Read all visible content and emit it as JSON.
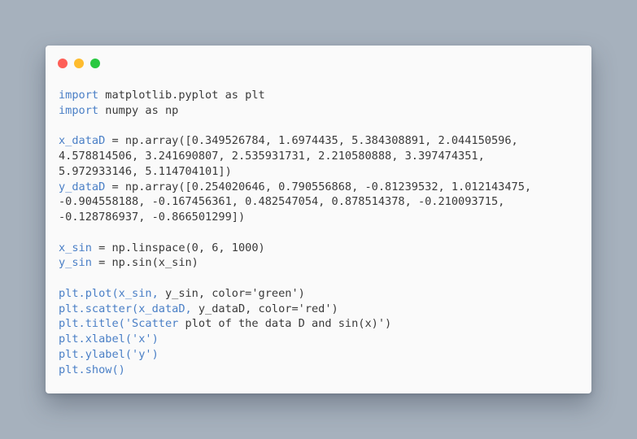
{
  "window": {
    "controls": [
      {
        "name": "close",
        "color": "#fe5f57"
      },
      {
        "name": "minimize",
        "color": "#febc2e"
      },
      {
        "name": "maximize",
        "color": "#28c840"
      }
    ]
  },
  "colors": {
    "background": "#a6b1bd",
    "editor_background": "#fafafa",
    "keyword": "#4a7fc6",
    "text": "#3a3a3a"
  },
  "code_lines": [
    [
      {
        "text": "import",
        "blue": true
      },
      {
        "text": " matplotlib.pyplot as plt"
      }
    ],
    [
      {
        "text": "import",
        "blue": true
      },
      {
        "text": " numpy as np"
      }
    ],
    [],
    [
      {
        "text": "x_dataD",
        "blue": true
      },
      {
        "text": " = np.array([0.349526784, 1.6974435, 5.384308891, 2.044150596,"
      }
    ],
    [
      {
        "text": "4.578814506, 3.241690807, 2.535931731, 2.210580888, 3.397474351,"
      }
    ],
    [
      {
        "text": "5.972933146, 5.114704101])"
      }
    ],
    [
      {
        "text": "y_dataD",
        "blue": true
      },
      {
        "text": " = np.array([0.254020646, 0.790556868, -0.81239532, 1.012143475,"
      }
    ],
    [
      {
        "text": "-0.904558188, -0.167456361, 0.482547054, 0.878514378, -0.210093715,"
      }
    ],
    [
      {
        "text": "-0.128786937, -0.866501299])"
      }
    ],
    [],
    [
      {
        "text": "x_sin",
        "blue": true
      },
      {
        "text": " = np.linspace(0, 6, 1000)"
      }
    ],
    [
      {
        "text": "y_sin",
        "blue": true
      },
      {
        "text": " = np.sin(x_sin)"
      }
    ],
    [],
    [
      {
        "text": "plt.plot(x_sin,",
        "blue": true
      },
      {
        "text": " y_sin, color='green')"
      }
    ],
    [
      {
        "text": "plt.scatter(x_dataD,",
        "blue": true
      },
      {
        "text": " y_dataD, color='red')"
      }
    ],
    [
      {
        "text": "plt.title('Scatter",
        "blue": true
      },
      {
        "text": " plot of the data D and sin(x)')"
      }
    ],
    [
      {
        "text": "plt.xlabel('x')",
        "blue": true
      }
    ],
    [
      {
        "text": "plt.ylabel('y')",
        "blue": true
      }
    ],
    [
      {
        "text": "plt.show()",
        "blue": true
      }
    ]
  ]
}
